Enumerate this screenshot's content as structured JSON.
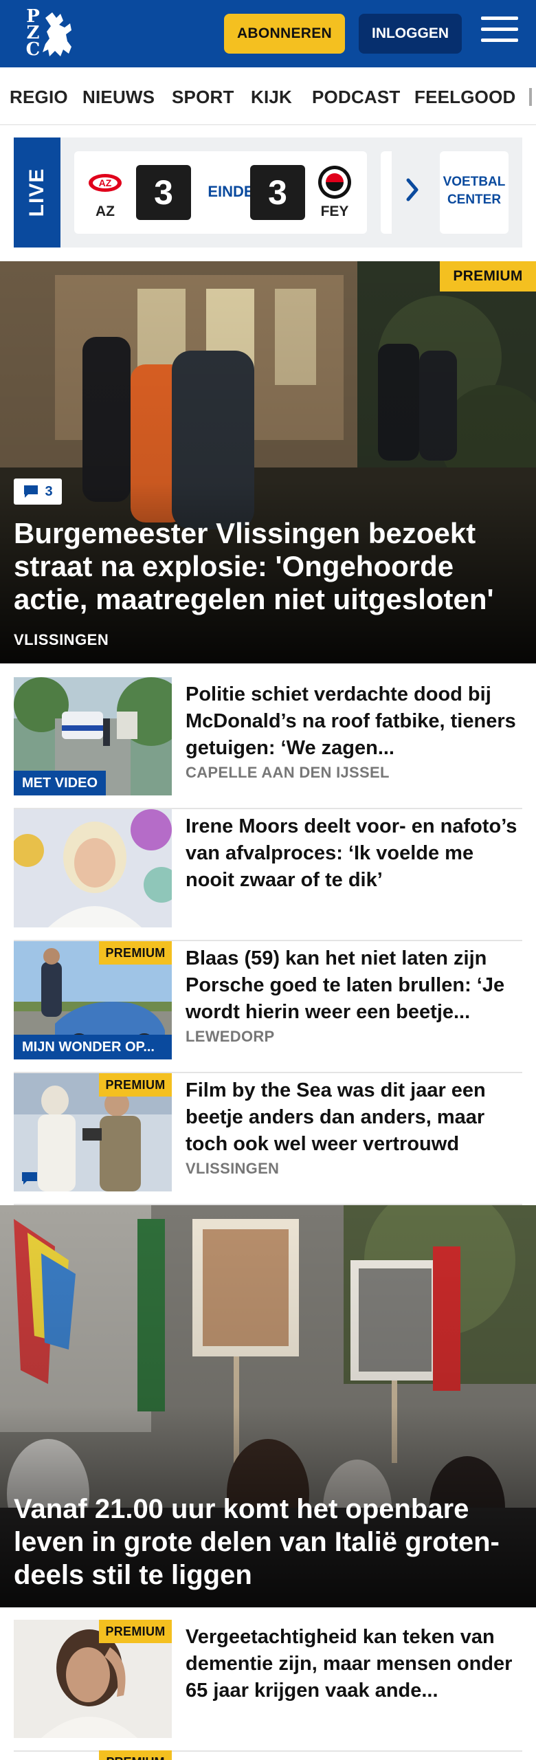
{
  "header": {
    "logo_letters": [
      "P",
      "Z",
      "C"
    ],
    "subscribe_label": "ABONNEREN",
    "login_label": "INLOGGEN",
    "brand_color": "#0a4a9e",
    "accent_color": "#f4c020"
  },
  "nav": {
    "items": [
      "REGIO",
      "NIEUWS",
      "SPORT",
      "KIJK",
      "PODCAST",
      "FEELGOOD"
    ]
  },
  "live": {
    "tab_label": "LIVE",
    "match": {
      "home_team": "AZ",
      "away_team": "FEY",
      "home_score": "3",
      "away_score": "3",
      "status": "EINDE"
    },
    "voetbal_center": [
      "VOETBAL",
      "CENTER"
    ]
  },
  "hero": {
    "premium_label": "PREMIUM",
    "comment_count": "3",
    "title": "Burgemeester Vlissingen bezoekt straat na explosie: 'Ongehoorde actie, maatregelen niet uitgesloten'",
    "location": "VLISSINGEN"
  },
  "articles": [
    {
      "title": "Politie schiet verdachte dood bij McDonald’s na roof fatbike, tieners getuigen: ‘We zagen...",
      "location": "CAPELLE AAN DEN IJSSEL",
      "thumb_label": "MET VIDEO",
      "premium": ""
    },
    {
      "title": "Irene Moors deelt voor- en nafoto’s van afvalproces: ‘Ik voelde me nooit zwaar of te dik’",
      "location": "",
      "thumb_label": "",
      "premium": ""
    },
    {
      "title": "Blaas (59) kan het niet laten zijn Porsche goed te laten brullen: ‘Je wordt hierin weer een beetje...",
      "location": "LEWEDORP",
      "thumb_label": "MIJN WONDER OP...",
      "premium": "PREMIUM"
    },
    {
      "title": "Film by the Sea was dit jaar een beetje anders dan anders, maar toch ook wel weer vertrouwd",
      "location": "VLISSINGEN",
      "thumb_label": "",
      "premium": "PREMIUM"
    }
  ],
  "hero2": {
    "title": "Vanaf 21.00 uur komt het openbare leven in grote delen van Italië groten-deels stil te liggen"
  },
  "article_bottom": {
    "title": "Vergeetachtigheid kan teken van dementie zijn, maar mensen onder 65 jaar krijgen vaak ande...",
    "premium": "PREMIUM"
  },
  "article_clipped": {
    "premium": "PREMIUM"
  }
}
